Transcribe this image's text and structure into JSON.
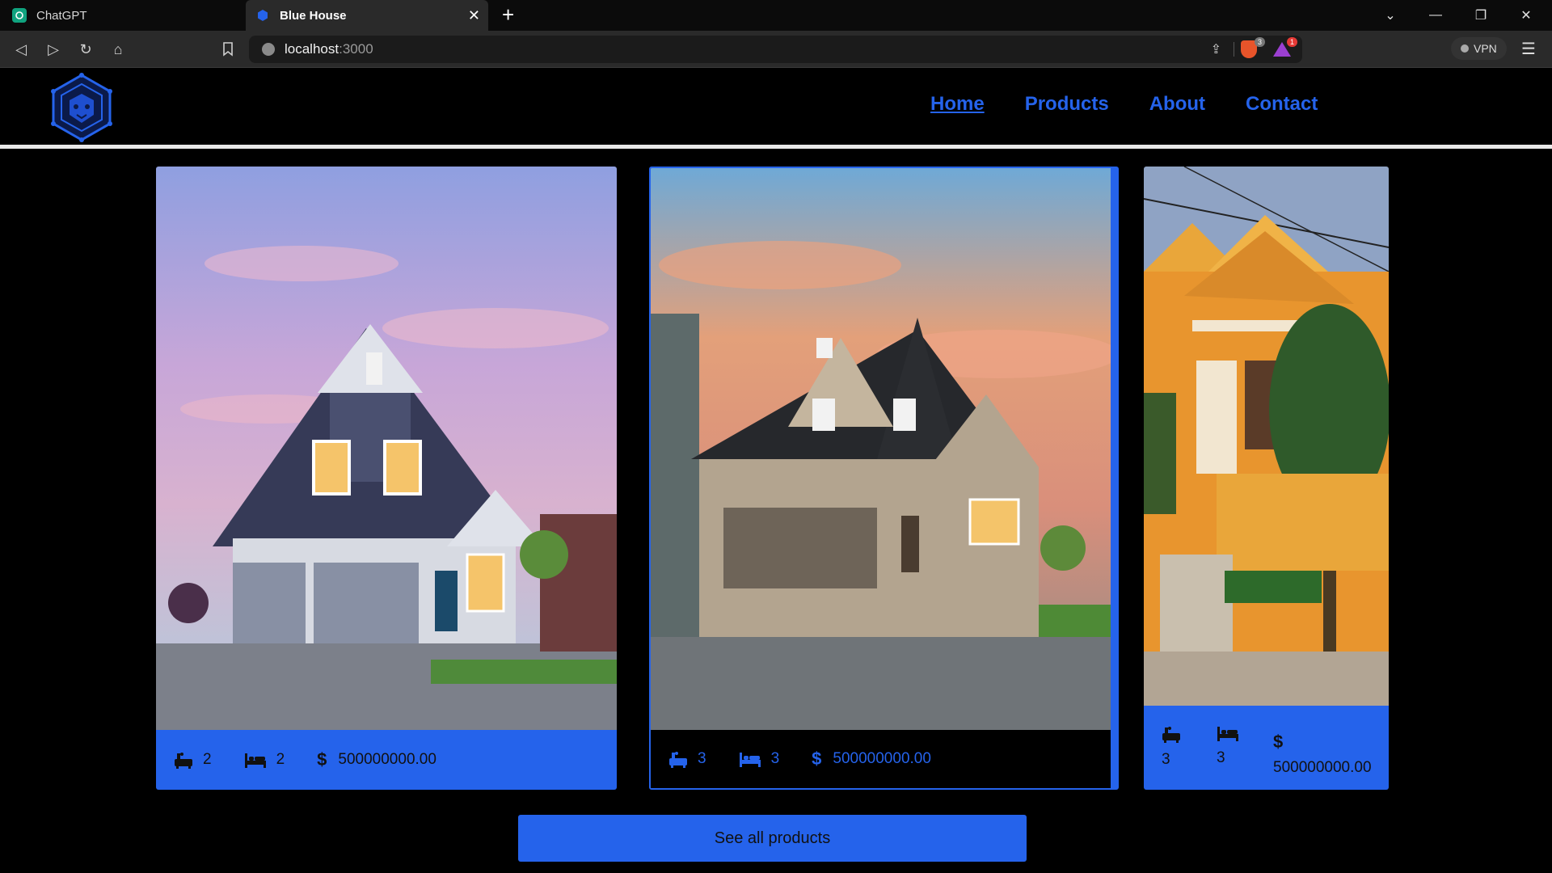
{
  "browser": {
    "tabs": [
      {
        "title": "ChatGPT",
        "active": false
      },
      {
        "title": "Blue House",
        "active": true
      }
    ],
    "url_host": "localhost",
    "url_port": ":3000",
    "brave_badge": "3",
    "rewards_badge": "1",
    "vpn_label": "VPN"
  },
  "site": {
    "nav": [
      {
        "label": "Home",
        "active": true
      },
      {
        "label": "Products",
        "active": false
      },
      {
        "label": "About",
        "active": false
      },
      {
        "label": "Contact",
        "active": false
      }
    ],
    "accent_color": "#2563eb"
  },
  "cards": [
    {
      "baths": "2",
      "beds": "2",
      "price": "500000000.00",
      "image": "blue-house-photo"
    },
    {
      "baths": "3",
      "beds": "3",
      "price": "500000000.00",
      "image": "beige-house-photo"
    },
    {
      "baths": "3",
      "beds": "3",
      "price": "500000000.00",
      "image": "yellow-house-photo"
    }
  ],
  "see_all_label": "See all products"
}
